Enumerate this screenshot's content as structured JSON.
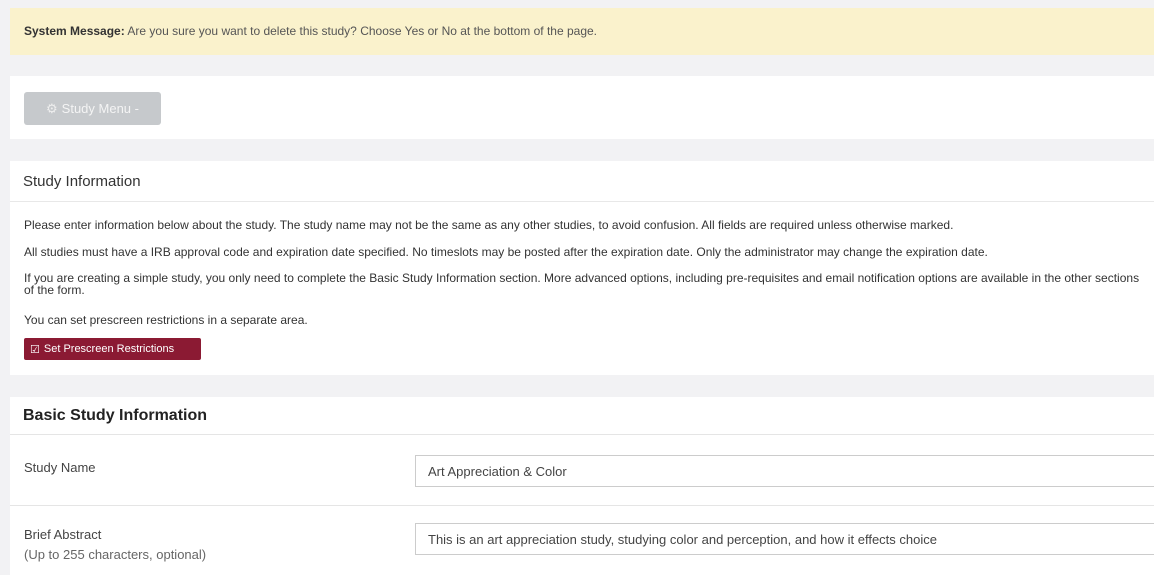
{
  "system_message": {
    "label": "System Message:",
    "text": "Are you sure you want to delete this study? Choose Yes or No at the bottom of the page."
  },
  "study_menu": {
    "icon": "gears-icon",
    "label": "Study Menu -"
  },
  "study_information": {
    "title": "Study Information",
    "paragraphs": [
      "Please enter information below about the study. The study name may not be the same as any other studies, to avoid confusion. All fields are required unless otherwise marked.",
      "All studies must have a IRB approval code and expiration date specified. No timeslots may be posted after the expiration date. Only the administrator may change the expiration date.",
      "If you are creating a simple study, you only need to complete the Basic Study Information section. More advanced options, including pre-requisites and email notification options are available in the other sections of the form.",
      "You can set prescreen restrictions in a separate area."
    ],
    "prescreen_button": "Set Prescreen Restrictions"
  },
  "basic_study_information": {
    "title": "Basic Study Information",
    "study_name": {
      "label": "Study Name",
      "value": "Art Appreciation & Color"
    },
    "brief_abstract": {
      "label": "Brief Abstract",
      "sublabel": "(Up to 255 characters, optional)",
      "value": "This is an art appreciation study, studying color and perception, and how it effects choice"
    }
  },
  "colors": {
    "system_message_bg": "#faf2cc",
    "study_menu_bg": "#c6c9cc",
    "prescreen_button_bg": "#8b1a33",
    "page_bg": "#f2f2f4"
  }
}
